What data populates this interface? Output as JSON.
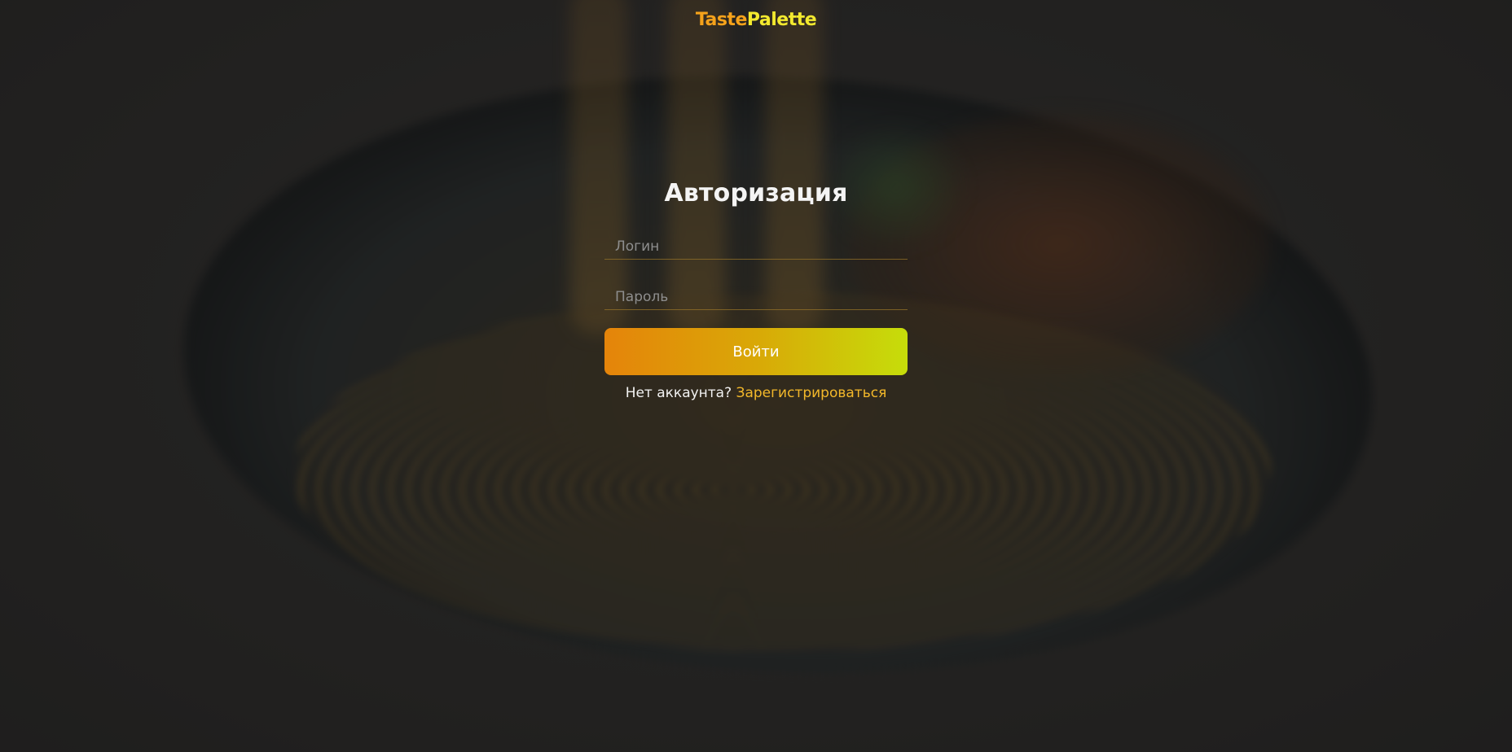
{
  "brand": {
    "part1": "Taste",
    "part2": "Palette",
    "colors": {
      "part1": "#f5a21b",
      "part2": "#f3e92f"
    }
  },
  "login_form": {
    "title": "Авторизация",
    "login_placeholder": "Логин",
    "password_placeholder": "Пароль",
    "submit_label": "Войти",
    "no_account_text": "Нет аккаунта?",
    "register_link": "Зарегистрироваться"
  },
  "colors": {
    "button_gradient_start": "#e5840a",
    "button_gradient_end": "#c6dd0a",
    "link": "#f3b82a"
  }
}
